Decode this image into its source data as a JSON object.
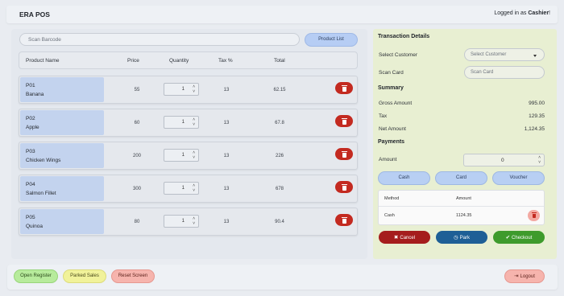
{
  "header": {
    "title": "ERA POS",
    "login_prefix": "Logged in as ",
    "user": "Cashier",
    "login_suffix": "!"
  },
  "search": {
    "placeholder": "Scan Barcode",
    "product_list_label": "Product List"
  },
  "table": {
    "columns": [
      "Product Name",
      "Price",
      "Quantity",
      "Tax %",
      "Total"
    ],
    "rows": [
      {
        "code": "P01",
        "name": "Banana",
        "price": "55",
        "qty": "1",
        "tax": "13",
        "total": "62.15"
      },
      {
        "code": "P02",
        "name": "Apple",
        "price": "60",
        "qty": "1",
        "tax": "13",
        "total": "67.8"
      },
      {
        "code": "P03",
        "name": "Chicken Wings",
        "price": "200",
        "qty": "1",
        "tax": "13",
        "total": "226"
      },
      {
        "code": "P04",
        "name": "Salmon Fillet",
        "price": "300",
        "qty": "1",
        "tax": "13",
        "total": "678"
      },
      {
        "code": "P05",
        "name": "Quinoa",
        "price": "80",
        "qty": "1",
        "tax": "13",
        "total": "90.4"
      }
    ]
  },
  "transaction": {
    "heading": "Transaction Details",
    "customer_label": "Select Customer",
    "customer_placeholder": "Select Customer",
    "card_label": "Scan Card",
    "card_placeholder": "Scan Card",
    "summary_heading": "Summary",
    "gross_label": "Gross Amount",
    "gross_value": "995.00",
    "tax_label": "Tax",
    "tax_value": "129.35",
    "net_label": "Net Amount",
    "net_value": "1,124.35",
    "payments_heading": "Payments",
    "amount_label": "Amount",
    "amount_value": "0",
    "pay_methods": [
      "Cash",
      "Card",
      "Voucher"
    ],
    "pay_table": {
      "col_method": "Method",
      "col_amount": "Amount",
      "rows": [
        {
          "method": "Cash",
          "amount": "1124.35"
        }
      ]
    },
    "cancel_label": "Cancel",
    "park_label": "Park",
    "checkout_label": "Checkout"
  },
  "footer": {
    "open_register": "Open Register",
    "parked_sales": "Parked Sales",
    "reset_screen": "Reset Screen",
    "logout": "Logout"
  },
  "colors": {
    "accent_blue": "#b6cdf4",
    "danger_red": "#c32a20",
    "park_blue": "#1e5f96",
    "checkout_green": "#3e9b2c",
    "right_panel_bg": "#e8efd2",
    "cancel_red": "#a51d1d"
  }
}
